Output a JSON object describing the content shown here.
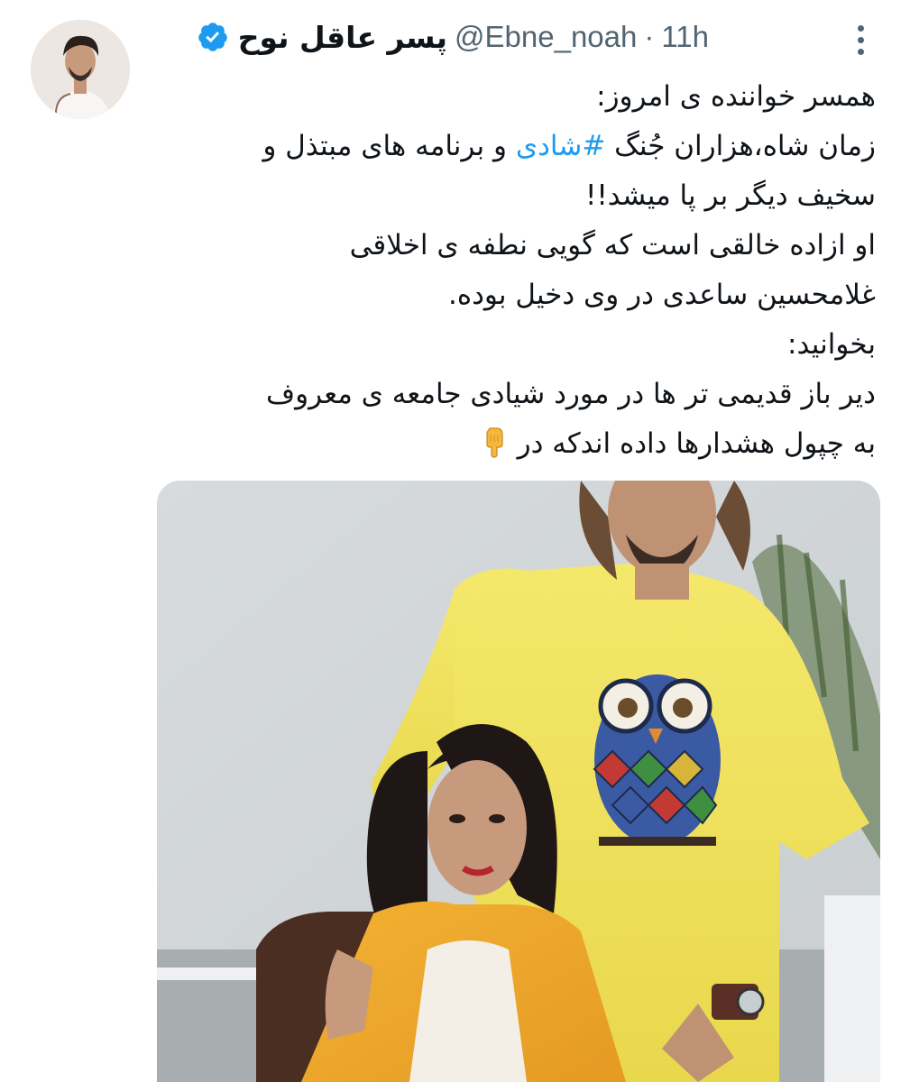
{
  "tweet": {
    "author": {
      "name": "پسر عاقل نوح",
      "handle": "@Ebne_noah",
      "verified": true,
      "avatar_icon": "profile-avatar"
    },
    "separator": "·",
    "time": "11h",
    "more_icon": "more-vertical-icon",
    "text": {
      "line1": "همسر خواننده ی امروز:",
      "line2_before": "زمان شاه،هزاران جُنگ",
      "line2_hashtag": "#شادی",
      "line2_after": "و برنامه های مبتذل و",
      "line3": "سخیف دیگر بر پا میشد!!",
      "line4": "او ازاده خالقی است که گویی نطفه ی اخلاقی",
      "line5": "غلامحسین ساعدی در وی دخیل بوده.",
      "line6": "بخوانید:",
      "line7": "دیر باز قدیمی تر ها در مورد شیادی جامعه ی معروف",
      "line8": "به چپول هشدارها داده اندکه در",
      "pointing_emoji": "backhand-index-pointing-down-icon"
    },
    "media": {
      "description_icon": "tweet-photo",
      "shirt_graphic": "owl-shirt-icon"
    }
  },
  "colors": {
    "text": "#0f1419",
    "secondary": "#536471",
    "link": "#1d9bf0",
    "verified": "#1d9bf0"
  }
}
